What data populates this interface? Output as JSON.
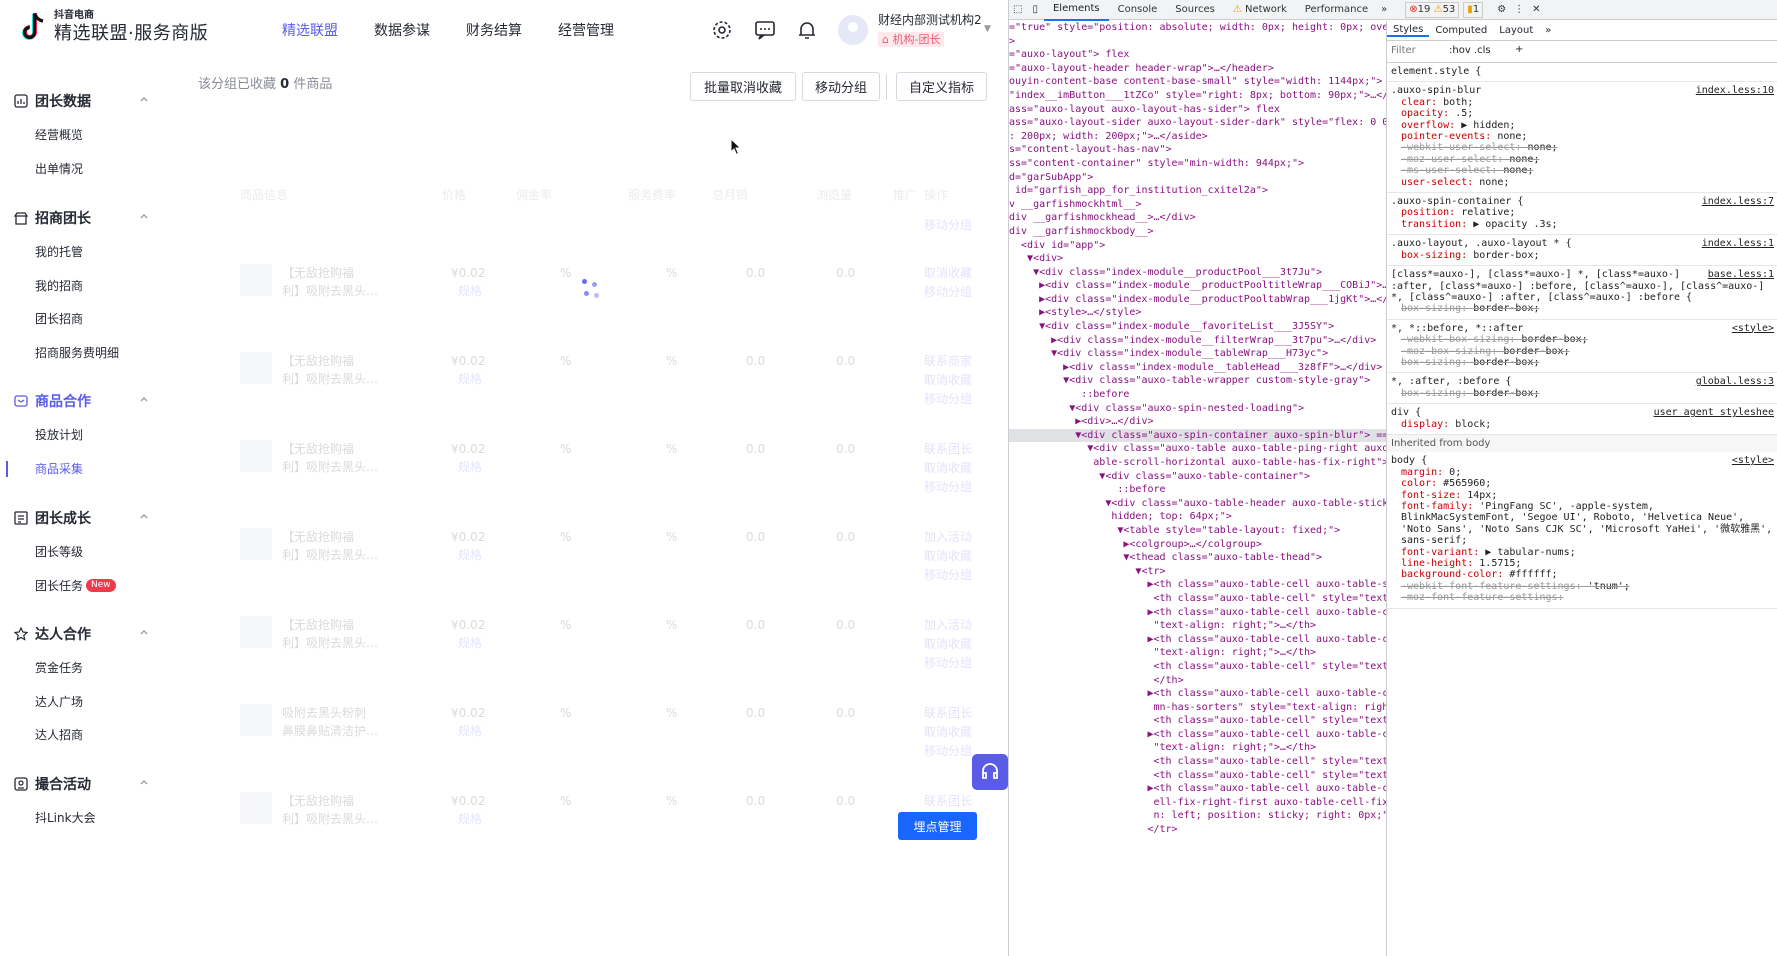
{
  "app": {
    "brand_small": "抖音电商",
    "brand_big": "精选联盟·服务商版",
    "nav": [
      "精选联盟",
      "数据参谋",
      "财务结算",
      "经营管理"
    ],
    "user_name": "财经内部测试机构2",
    "user_role": "机构-团长"
  },
  "sidebar": [
    {
      "title": "团长数据",
      "icon": "chart-icon",
      "items": [
        "经营概览",
        "出单情况"
      ]
    },
    {
      "title": "招商团长",
      "icon": "store-icon",
      "items": [
        "我的托管",
        "我的招商",
        "团长招商",
        "招商服务费明细"
      ]
    },
    {
      "title": "商品合作",
      "icon": "box-icon",
      "items": [
        "投放计划",
        "商品采集"
      ]
    },
    {
      "title": "团长成长",
      "icon": "growth-icon",
      "items": [
        "团长等级",
        "团长任务"
      ]
    },
    {
      "title": "达人合作",
      "icon": "star-icon",
      "items": [
        "赏金任务",
        "达人广场",
        "达人招商"
      ]
    },
    {
      "title": "撮合活动",
      "icon": "event-icon",
      "items": [
        "抖Link大会"
      ]
    }
  ],
  "sidebar_badge": "New",
  "content": {
    "fav_prefix": "该分组已收藏",
    "fav_count": "0",
    "fav_suffix": "件商品",
    "buttons": [
      "批量取消收藏",
      "移动分组",
      "自定义指标"
    ],
    "headers": [
      "商品信息",
      "价格",
      "佣金率",
      "服务费率",
      "总月销",
      "浏览量",
      "推广",
      "操作"
    ],
    "rows": [
      {
        "title1": "【无敌抢购福",
        "title2": "利】吸附去黑头…",
        "price": "¥0.02",
        "spec": "规格",
        "commission": "%",
        "fee": "%",
        "sales": "0.0",
        "views": "0.0",
        "actions": [
          "取消收藏",
          "移动分组"
        ]
      },
      {
        "title1": "【无敌抢购福",
        "title2": "利】吸附去黑头…",
        "price": "¥0.02",
        "spec": "规格",
        "commission": "%",
        "fee": "%",
        "sales": "0.0",
        "views": "0.0",
        "actions": [
          "联系商家",
          "取消收藏",
          "移动分组"
        ]
      },
      {
        "title1": "【无敌抢购福",
        "title2": "利】吸附去黑头…",
        "price": "¥0.02",
        "spec": "规格",
        "commission": "%",
        "fee": "%",
        "sales": "0.0",
        "views": "0.0",
        "actions": [
          "联系团长",
          "取消收藏",
          "移动分组"
        ]
      },
      {
        "title1": "【无敌抢购福",
        "title2": "利】吸附去黑头…",
        "price": "¥0.02",
        "spec": "规格",
        "commission": "%",
        "fee": "%",
        "sales": "0.0",
        "views": "0.0",
        "actions": [
          "加入活动",
          "取消收藏",
          "移动分组"
        ]
      },
      {
        "title1": "【无敌抢购福",
        "title2": "利】吸附去黑头…",
        "price": "¥0.02",
        "spec": "规格",
        "commission": "%",
        "fee": "%",
        "sales": "0.0",
        "views": "0.0",
        "actions": [
          "加入活动",
          "取消收藏",
          "移动分组"
        ]
      },
      {
        "title1": "吸附去黑头粉刺",
        "title2": "鼻膜鼻贴清洁护…",
        "price": "¥0.02",
        "spec": "规格",
        "commission": "%",
        "fee": "%",
        "sales": "0.0",
        "views": "0.0",
        "actions": [
          "联系团长",
          "取消收藏",
          "移动分组"
        ]
      },
      {
        "title1": "【无敌抢购福",
        "title2": "利】吸附去黑头…",
        "price": "¥0.02",
        "spec": "规格",
        "commission": "%",
        "fee": "%",
        "sales": "0.0",
        "views": "0.0",
        "actions": [
          "联系团长"
        ]
      }
    ],
    "first_action": "移动分组",
    "mgmt_button": "埋点管理"
  },
  "devtools": {
    "tabs": [
      "Elements",
      "Console",
      "Sources",
      "Network",
      "Performance"
    ],
    "errors": "19",
    "warnings": "53",
    "issues": "1",
    "style_tabs": [
      "Styles",
      "Computed",
      "Layout"
    ],
    "filter": "Filter",
    "filter_right": ":hov .cls",
    "dom_lines": [
      "=\"true\" style=\"position: absolute; width: 0px; height: 0px; overf",
      ">",
      "=\"auxo-layout\"> flex",
      "=\"auxo-layout-header header-wrap\">…</header>",
      "ouyin-content-base content-base-small\" style=\"width: 1144px;\">",
      "\"index__imButton___1tZCo\" style=\"right: 8px; bottom: 90px;\">…</di",
      "ass=\"auxo-layout auxo-layout-has-sider\"> flex",
      "ass=\"auxo-layout-sider auxo-layout-sider-dark\" style=\"flex: 0 0 2",
      ": 200px; width: 200px;\">…</aside>",
      "s=\"content-layout-has-nav\">",
      "ss=\"content-container\" style=\"min-width: 944px;\">",
      "d=\"garSubApp\">",
      " id=\"garfish_app_for_institution_cxitel2a\">",
      "v __garfishmockhtml__>",
      "div __garfishmockhead__>…</div>",
      "div __garfishmockbody__>",
      "  <div id=\"app\">",
      "   ▼<div>",
      "    ▼<div class=\"index-module__productPool___3t7Ju\">",
      "     ▶<div class=\"index-module__productPooltitleWrap___COBiJ\">…</",
      "     ▶<div class=\"index-module__productPooltabWrap___1jgKt\">…</di",
      "     ▶<style>…</style>",
      "     ▼<div class=\"index-module__favoriteList___3J5SY\">",
      "       ▶<div class=\"index-module__filterWrap___3t7pu\">…</div>",
      "       ▼<div class=\"index-module__tableWrap___H73yc\">",
      "         ▶<div class=\"index-module__tableHead___3z8fF\">…</div> fle",
      "         ▼<div class=\"auxo-table-wrapper custom-style-gray\">",
      "            ::before",
      "          ▼<div class=\"auxo-spin-nested-loading\">",
      "           ▶<div>…</div>",
      "           ▼<div class=\"auxo-spin-container auxo-spin-blur\"> == $0",
      "             ▼<div class=\"auxo-table auxo-table-ping-right auxo-t",
      "              able-scroll-horizontal auxo-table-has-fix-right\">",
      "               ▼<div class=\"auxo-table-container\">",
      "                  ::before",
      "                ▼<div class=\"auxo-table-header auxo-table-sticky-",
      "                 hidden; top: 64px;\">",
      "                  ▼<table style=\"table-layout: fixed;\">",
      "                   ▶<colgroup>…</colgroup>",
      "                   ▼<thead class=\"auxo-table-thead\">",
      "                     ▼<tr>",
      "                       ▶<th class=\"auxo-table-cell auxo-table-sel",
      "                        <th class=\"auxo-table-cell\" style=\"text-a",
      "                       ▶<th class=\"auxo-table-cell auxo-table-col",
      "                        \"text-align: right;\">…</th>",
      "                       ▶<th class=\"auxo-table-cell auxo-table-col",
      "                        \"text-align: right;\">…</th>",
      "                        <th class=\"auxo-table-cell\" style=\"text-a",
      "                        </th>",
      "                       ▶<th class=\"auxo-table-cell auxo-table-col",
      "                        mn-has-sorters\" style=\"text-align: right;",
      "                        <th class=\"auxo-table-cell\" style=\"text-a",
      "                       ▶<th class=\"auxo-table-cell auxo-table-col",
      "                        \"text-align: right;\">…</th>",
      "                        <th class=\"auxo-table-cell\" style=\"text-a",
      "                        <th class=\"auxo-table-cell\" style=\"text-a",
      "                       ▶<th class=\"auxo-table-cell auxo-table-cel",
      "                        ell-fix-right-first auxo-table-cell-fix-s",
      "                        n: left; position: sticky; right: 0px;\">",
      "                       </tr>"
    ],
    "style_rules": [
      {
        "sel": "element.style {",
        "src": "",
        "props": []
      },
      {
        "sel": ".auxo-spin-blur",
        "src": "index.less:10",
        "props": [
          [
            "clear",
            "both;",
            false
          ],
          [
            "opacity",
            ".5;",
            false
          ],
          [
            "overflow",
            "▶ hidden;",
            false
          ],
          [
            "pointer-events",
            "none;",
            false
          ],
          [
            "-webkit-user-select",
            "none;",
            true
          ],
          [
            "-moz-user-select",
            "none;",
            true
          ],
          [
            "-ms-user-select",
            "none;",
            true
          ],
          [
            "user-select",
            "none;",
            false
          ]
        ]
      },
      {
        "sel": ".auxo-spin-container {",
        "src": "index.less:7",
        "props": [
          [
            "position",
            "relative;",
            false
          ],
          [
            "transition",
            "▶ opacity .3s;",
            false
          ]
        ]
      },
      {
        "sel": ".auxo-layout, .auxo-layout * {",
        "src": "index.less:1",
        "props": [
          [
            "box-sizing",
            "border-box;",
            false
          ]
        ]
      },
      {
        "sel": "[class*=auxo-], [class*=auxo-] *, [class*=auxo-] :after, [class*=auxo-] :before, [class^=auxo-], [class^=auxo-] *, [class^=auxo-] :after, [class^=auxo-] :before {",
        "src": "base.less:1",
        "props": [
          [
            "box-sizing",
            "border-box;",
            true
          ]
        ]
      },
      {
        "sel": "*, *::before, *::after",
        "src": "<style>",
        "props": [
          [
            "-webkit-box-sizing",
            "border-box;",
            true
          ],
          [
            "-moz-box-sizing",
            "border-box;",
            true
          ],
          [
            "box-sizing",
            "border-box;",
            true
          ]
        ]
      },
      {
        "sel": "*, :after, :before {",
        "src": "global.less:3",
        "props": [
          [
            "box-sizing",
            "border-box;",
            true
          ]
        ]
      },
      {
        "sel": "div {",
        "src": "user agent styleshee",
        "props": [
          [
            "display",
            "block;",
            false
          ]
        ]
      }
    ],
    "inherited": "Inherited from body",
    "body_rule": {
      "sel": "body {",
      "src": "<style>",
      "props": [
        [
          "margin",
          "0;",
          false
        ],
        [
          "color",
          "#565960;",
          false
        ],
        [
          "font-size",
          "14px;",
          false
        ],
        [
          "font-family",
          "'PingFang SC', -apple-system, BlinkMacSystemFont, 'Segoe UI', Roboto, 'Helvetica Neue', 'Noto Sans', 'Noto Sans CJK SC', 'Microsoft YaHei', '微软雅黑', sans-serif;",
          false
        ],
        [
          "font-variant",
          "▶ tabular-nums;",
          false
        ],
        [
          "line-height",
          "1.5715;",
          false
        ],
        [
          "background-color",
          "#ffffff;",
          false
        ],
        [
          "-webkit-font-feature-settings",
          "'tnum';",
          true
        ],
        [
          "-moz-font-feature-settings",
          "",
          true
        ]
      ]
    }
  }
}
